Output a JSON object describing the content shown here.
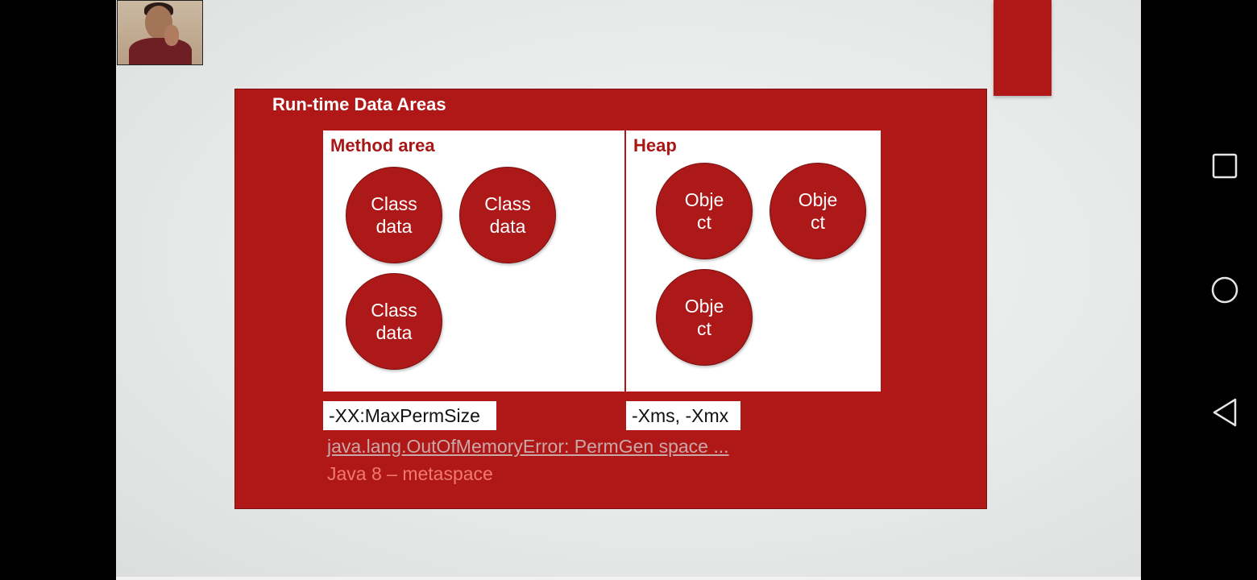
{
  "slide": {
    "title": "Run-time Data Areas",
    "method_area": {
      "title": "Method area",
      "circles": [
        "Class\ndata",
        "Class\ndata",
        "Class\ndata"
      ],
      "flag": "-XX:MaxPermSize"
    },
    "heap": {
      "title": "Heap",
      "circles": [
        "Obje\nct",
        "Obje\nct",
        "Obje\nct"
      ],
      "flag": "-Xms, -Xmx"
    },
    "error_link": "java.lang.OutOfMemoryError: PermGen space ...",
    "java8_note": "Java 8 – metaspace"
  },
  "colors": {
    "accent_red": "#b01717",
    "note_color": "#f07a6e"
  },
  "nav": {
    "icons": [
      "recent-apps-icon",
      "home-icon",
      "back-icon"
    ]
  }
}
